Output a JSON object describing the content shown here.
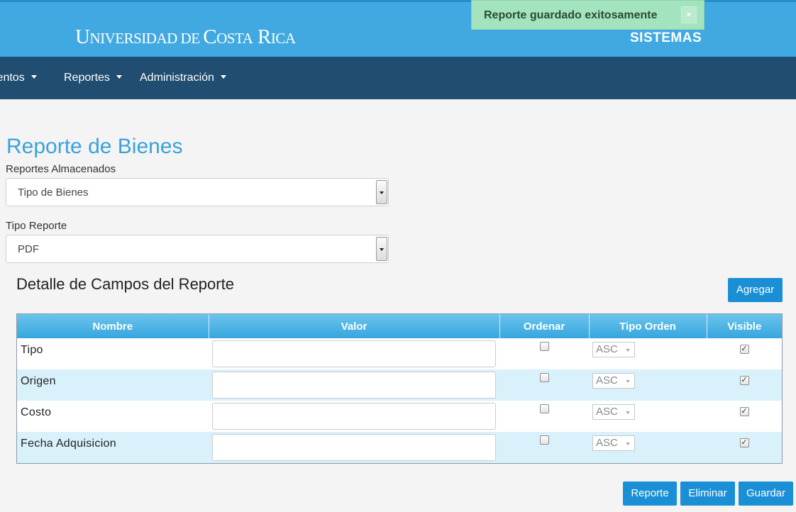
{
  "header": {
    "brand_part1": "U",
    "brand_part2": "NIVERSIDAD",
    "brand_part3": " DE ",
    "brand_part4": "C",
    "brand_part5": "OSTA",
    "brand_part6": " R",
    "brand_part7": "ICA",
    "brand_right": "SISTEMAS"
  },
  "toast": {
    "message": "Reporte guardado exitosamente",
    "close_glyph": "×"
  },
  "nav": {
    "items": [
      {
        "label": "ientos"
      },
      {
        "label": "Reportes"
      },
      {
        "label": "Administración"
      }
    ]
  },
  "page": {
    "title": "Reporte de Bienes",
    "stored_reports_label": "Reportes Almacenados",
    "stored_reports_value": "Tipo de Bienes",
    "report_type_label": "Tipo Reporte",
    "report_type_value": "PDF",
    "section_title": "Detalle de Campos del Reporte",
    "add_button": "Agregar"
  },
  "table": {
    "columns": [
      "Nombre",
      "Valor",
      "Ordenar",
      "Tipo Orden",
      "Visible"
    ],
    "rows": [
      {
        "nombre": "Tipo",
        "valor": "",
        "ordenar": false,
        "tipo_orden": "ASC",
        "visible": true
      },
      {
        "nombre": "Origen",
        "valor": "",
        "ordenar": false,
        "tipo_orden": "ASC",
        "visible": true
      },
      {
        "nombre": "Costo",
        "valor": "",
        "ordenar": false,
        "tipo_orden": "ASC",
        "visible": true
      },
      {
        "nombre": "Fecha Adquisicion",
        "valor": "",
        "ordenar": false,
        "tipo_orden": "ASC",
        "visible": true
      }
    ]
  },
  "footer_buttons": {
    "report": "Reporte",
    "delete": "Eliminar",
    "save": "Guardar"
  },
  "colors": {
    "top_bar": "#41a9e1",
    "nav_bar": "#204d70",
    "accent": "#1a8fd6",
    "toast_bg": "#a3e4bf",
    "title": "#3aa2dc"
  }
}
